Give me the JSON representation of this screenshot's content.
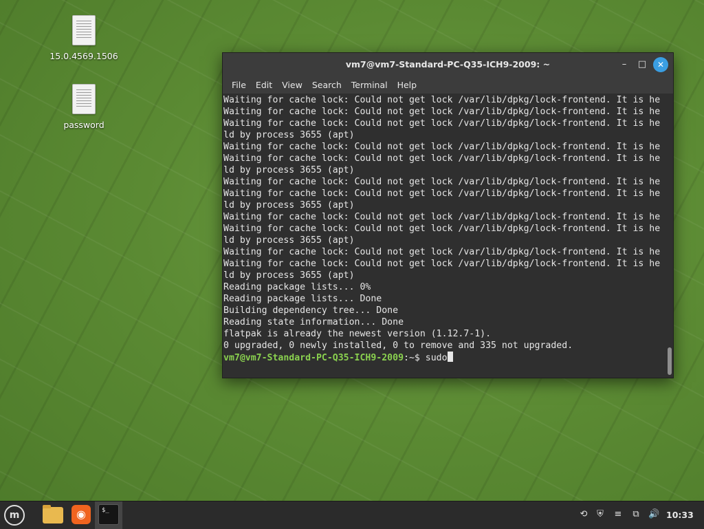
{
  "desktop": {
    "icons": [
      {
        "label": "15.0.4569.1506",
        "icon": "document-icon"
      },
      {
        "label": "password",
        "icon": "document-icon"
      }
    ],
    "background_color": "#5b8a33"
  },
  "window": {
    "title": "vm7@vm7-Standard-PC-Q35-ICH9-2009: ~",
    "controls": {
      "minimize": "–",
      "maximize": "□",
      "close": "✕"
    },
    "menu": [
      "File",
      "Edit",
      "View",
      "Search",
      "Terminal",
      "Help"
    ]
  },
  "terminal": {
    "lines": [
      "Waiting for cache lock: Could not get lock /var/lib/dpkg/lock-frontend. It is he",
      "Waiting for cache lock: Could not get lock /var/lib/dpkg/lock-frontend. It is he",
      "Waiting for cache lock: Could not get lock /var/lib/dpkg/lock-frontend. It is he",
      "ld by process 3655 (apt)",
      "Waiting for cache lock: Could not get lock /var/lib/dpkg/lock-frontend. It is he",
      "Waiting for cache lock: Could not get lock /var/lib/dpkg/lock-frontend. It is he",
      "ld by process 3655 (apt)",
      "Waiting for cache lock: Could not get lock /var/lib/dpkg/lock-frontend. It is he",
      "Waiting for cache lock: Could not get lock /var/lib/dpkg/lock-frontend. It is he",
      "ld by process 3655 (apt)",
      "Waiting for cache lock: Could not get lock /var/lib/dpkg/lock-frontend. It is he",
      "Waiting for cache lock: Could not get lock /var/lib/dpkg/lock-frontend. It is he",
      "ld by process 3655 (apt)",
      "Waiting for cache lock: Could not get lock /var/lib/dpkg/lock-frontend. It is he",
      "Waiting for cache lock: Could not get lock /var/lib/dpkg/lock-frontend. It is he",
      "ld by process 3655 (apt)",
      "Reading package lists... 0%",
      "Reading package lists... Done",
      "Building dependency tree... Done",
      "Reading state information... Done",
      "flatpak is already the newest version (1.12.7-1).",
      "0 upgraded, 0 newly installed, 0 to remove and 335 not upgraded."
    ],
    "prompt_user": "vm7@vm7-Standard-PC-Q35-ICH9-2009",
    "prompt_suffix": ":~$ ",
    "current_input": "sudo",
    "prompt_color": "#8ad14f",
    "text_color": "#e6e6e6",
    "background_color": "#2f2f2f"
  },
  "taskbar": {
    "apps": [
      {
        "name": "menu-icon",
        "glyph": "m"
      },
      {
        "name": "files-icon",
        "glyph": ""
      },
      {
        "name": "firefox-icon",
        "glyph": "◉"
      },
      {
        "name": "terminal-icon",
        "glyph": "$_"
      }
    ],
    "tray": [
      {
        "name": "update-icon",
        "glyph": "⟲"
      },
      {
        "name": "shield-icon",
        "glyph": "⛨"
      },
      {
        "name": "notes-icon",
        "glyph": "≡"
      },
      {
        "name": "network-icon",
        "glyph": "⧉"
      },
      {
        "name": "volume-icon",
        "glyph": "🔊"
      }
    ],
    "clock": "10:33",
    "background_color": "#2b2b2b"
  }
}
